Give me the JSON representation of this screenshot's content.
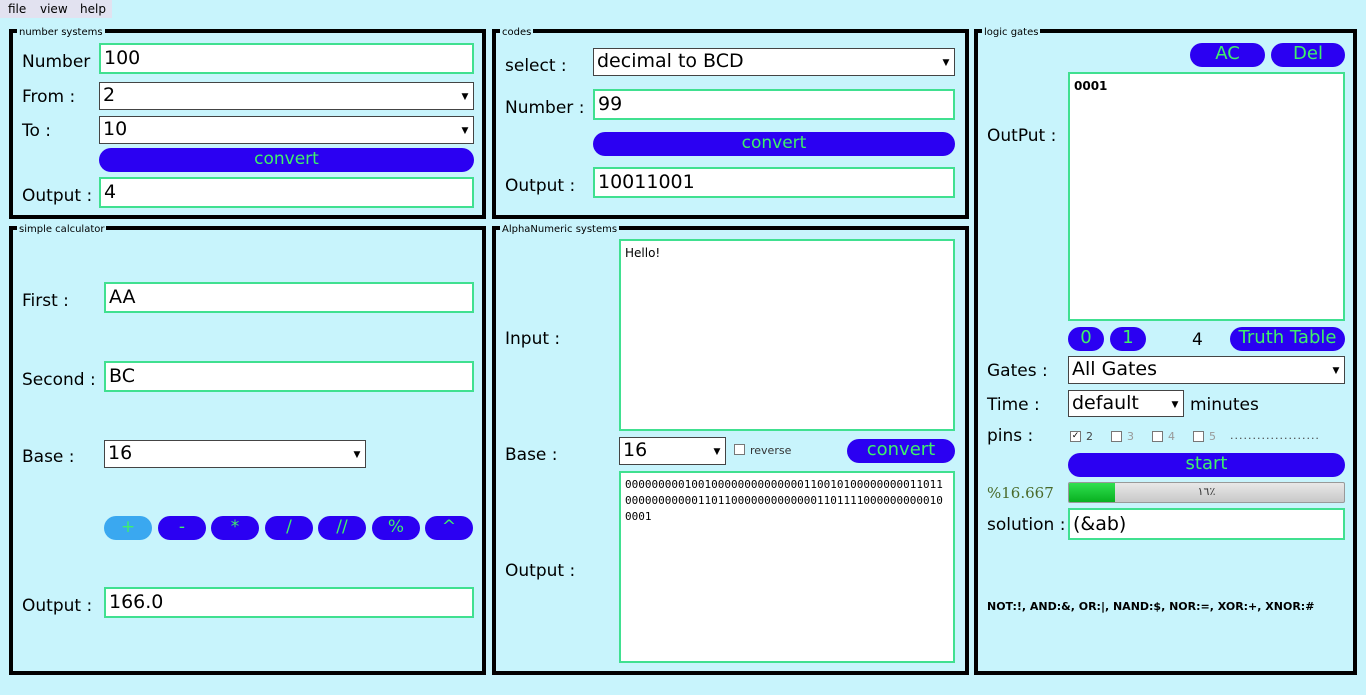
{
  "menu": {
    "file": "file",
    "view": "view",
    "help": "help"
  },
  "number_systems": {
    "title": "number systems",
    "number_label": "Number",
    "number_value": "100",
    "from_label": "From :",
    "from_value": "2",
    "to_label": "To :",
    "to_value": "10",
    "convert_label": "convert",
    "output_label": "Output :",
    "output_value": "4"
  },
  "codes": {
    "title": "codes",
    "select_label": "select :",
    "select_value": "decimal to BCD",
    "number_label": "Number :",
    "number_value": "99",
    "convert_label": "convert",
    "output_label": "Output :",
    "output_value": "10011001"
  },
  "logic_gates": {
    "title": "logic gates",
    "ac_label": "AC",
    "del_label": "Del",
    "output_label": "OutPut :",
    "output_value": "0001",
    "zero_label": "0",
    "one_label": "1",
    "count": "4",
    "truth_table_label": "Truth Table",
    "gates_label": "Gates :",
    "gates_value": "All Gates",
    "time_label": "Time :",
    "time_value": "default",
    "minutes_label": "minutes",
    "pins_label": "pins :",
    "pins": [
      {
        "label": "2",
        "checked": true
      },
      {
        "label": "3",
        "checked": false
      },
      {
        "label": "4",
        "checked": false
      },
      {
        "label": "5",
        "checked": false
      }
    ],
    "dots": "....................",
    "start_label": "start",
    "progress_text": "%16.667",
    "progress_fraction": 0.16667,
    "progress_bar_text": "١٦٪",
    "solution_label": "solution :",
    "solution_value": "(&ab)",
    "legend": "NOT:!, AND:&, OR:|, NAND:$, NOR:=, XOR:+, XNOR:#",
    "colors": {
      "progress_fill": "#10c830",
      "button_bg": "#2b00f2",
      "button_text": "#3ff06a"
    }
  },
  "calculator": {
    "title": "simple calculator",
    "first_label": "First  :",
    "first_value": "AA",
    "second_label": "Second :",
    "second_value": "BC",
    "base_label": "Base :",
    "base_value": "16",
    "ops": [
      "+",
      "-",
      "*",
      "/",
      "//",
      "%",
      "^"
    ],
    "output_label": "Output :",
    "output_value": "166.0"
  },
  "alphanumeric": {
    "title": "AlphaNumeric systems",
    "input_label": "Input :",
    "input_value": "Hello!",
    "base_label": "Base :",
    "base_value": "16",
    "reverse_label": "reverse",
    "convert_label": "convert",
    "output_label": "Output :",
    "output_value": "0000000001001000000000000001100101000000000110110000000000011011000000000000011011110000000000100001"
  }
}
